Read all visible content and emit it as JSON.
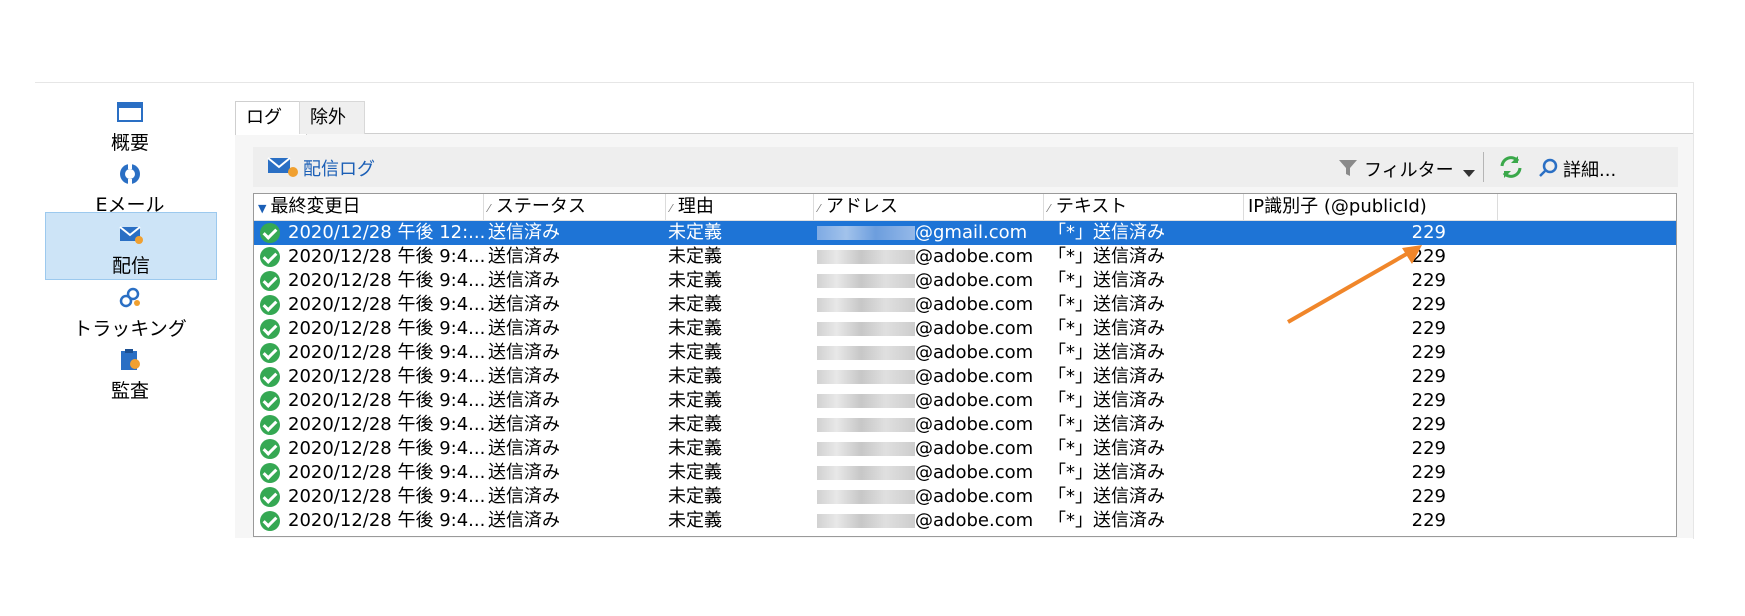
{
  "sidebar": {
    "items": [
      {
        "label": "概要",
        "icon": "window-icon"
      },
      {
        "label": "Eメール",
        "icon": "email-lifebuoy-icon"
      },
      {
        "label": "配信",
        "icon": "delivery-mail-icon",
        "active": true
      },
      {
        "label": "トラッキング",
        "icon": "tracking-link-icon"
      },
      {
        "label": "監査",
        "icon": "audit-icon"
      }
    ]
  },
  "tabs": [
    {
      "label": "ログ",
      "active": true
    },
    {
      "label": "除外",
      "active": false
    }
  ],
  "toolbar": {
    "title": "配信ログ",
    "filter_label": "フィルター",
    "details_label": "詳細..."
  },
  "table": {
    "columns": [
      "最終変更日",
      "ステータス",
      "理由",
      "アドレス",
      "テキスト",
      "IP識別子 (@publicId)"
    ],
    "rows": [
      {
        "date": "2020/12/28 午後 12:...",
        "status": "送信済み",
        "reason": "未定義",
        "address_suffix": "@gmail.com",
        "text": "「*」送信済み",
        "ip": "229",
        "selected": true
      },
      {
        "date": "2020/12/28 午後 9:4...",
        "status": "送信済み",
        "reason": "未定義",
        "address_suffix": "@adobe.com",
        "text": "「*」送信済み",
        "ip": "229"
      },
      {
        "date": "2020/12/28 午後 9:4...",
        "status": "送信済み",
        "reason": "未定義",
        "address_suffix": "@adobe.com",
        "text": "「*」送信済み",
        "ip": "229"
      },
      {
        "date": "2020/12/28 午後 9:4...",
        "status": "送信済み",
        "reason": "未定義",
        "address_suffix": "@adobe.com",
        "text": "「*」送信済み",
        "ip": "229"
      },
      {
        "date": "2020/12/28 午後 9:4...",
        "status": "送信済み",
        "reason": "未定義",
        "address_suffix": "@adobe.com",
        "text": "「*」送信済み",
        "ip": "229"
      },
      {
        "date": "2020/12/28 午後 9:4...",
        "status": "送信済み",
        "reason": "未定義",
        "address_suffix": "@adobe.com",
        "text": "「*」送信済み",
        "ip": "229"
      },
      {
        "date": "2020/12/28 午後 9:4...",
        "status": "送信済み",
        "reason": "未定義",
        "address_suffix": "@adobe.com",
        "text": "「*」送信済み",
        "ip": "229"
      },
      {
        "date": "2020/12/28 午後 9:4...",
        "status": "送信済み",
        "reason": "未定義",
        "address_suffix": "@adobe.com",
        "text": "「*」送信済み",
        "ip": "229"
      },
      {
        "date": "2020/12/28 午後 9:4...",
        "status": "送信済み",
        "reason": "未定義",
        "address_suffix": "@adobe.com",
        "text": "「*」送信済み",
        "ip": "229"
      },
      {
        "date": "2020/12/28 午後 9:4...",
        "status": "送信済み",
        "reason": "未定義",
        "address_suffix": "@adobe.com",
        "text": "「*」送信済み",
        "ip": "229"
      },
      {
        "date": "2020/12/28 午後 9:4...",
        "status": "送信済み",
        "reason": "未定義",
        "address_suffix": "@adobe.com",
        "text": "「*」送信済み",
        "ip": "229"
      },
      {
        "date": "2020/12/28 午後 9:4...",
        "status": "送信済み",
        "reason": "未定義",
        "address_suffix": "@adobe.com",
        "text": "「*」送信済み",
        "ip": "229"
      },
      {
        "date": "2020/12/28 午後 9:4...",
        "status": "送信済み",
        "reason": "未定義",
        "address_suffix": "@adobe.com",
        "text": "「*」送信済み",
        "ip": "229"
      }
    ]
  },
  "colors": {
    "selection": "#1e74d6",
    "accent_blue": "#1b5fb6",
    "success_green": "#35a853",
    "arrow": "#f0862a"
  }
}
